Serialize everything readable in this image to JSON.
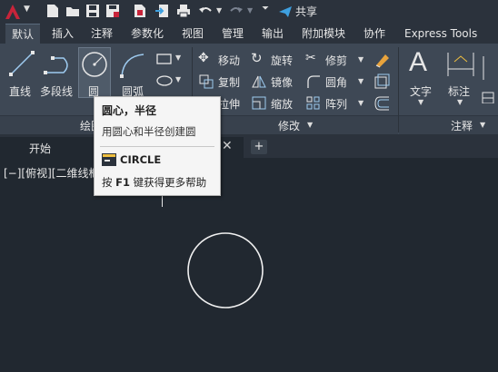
{
  "qat": {
    "share_label": "共享"
  },
  "tabs": [
    {
      "label": "默认",
      "active": true
    },
    {
      "label": "插入"
    },
    {
      "label": "注释"
    },
    {
      "label": "参数化"
    },
    {
      "label": "视图"
    },
    {
      "label": "管理"
    },
    {
      "label": "输出"
    },
    {
      "label": "附加模块"
    },
    {
      "label": "协作"
    },
    {
      "label": "Express Tools"
    }
  ],
  "draw_panel": {
    "line": "直线",
    "polyline": "多段线",
    "circle": "圆",
    "arc": "圆弧",
    "footer": "绘图"
  },
  "modify_panel": {
    "move": "移动",
    "rotate": "旋转",
    "trim": "修剪",
    "copy": "复制",
    "mirror": "镜像",
    "fillet": "圆角",
    "stretch": "拉伸",
    "scale": "缩放",
    "array": "阵列",
    "footer": "修改"
  },
  "annotation_panel": {
    "text": "文字",
    "dimension": "标注",
    "footer": "注释"
  },
  "doc_tabs": {
    "start": "开始"
  },
  "viewport": {
    "label": "[−][俯视][二维线框]"
  },
  "tooltip": {
    "title": "圆心，半径",
    "description": "用圆心和半径创建圆",
    "command": "CIRCLE",
    "help_prefix": "按 ",
    "help_key": "F1",
    "help_suffix": " 键获得更多帮助"
  },
  "colors": {
    "accent": "#c8243a",
    "canvas": "#212830",
    "ribbon": "#3e4855",
    "share_icon": "#3ea0e0"
  }
}
